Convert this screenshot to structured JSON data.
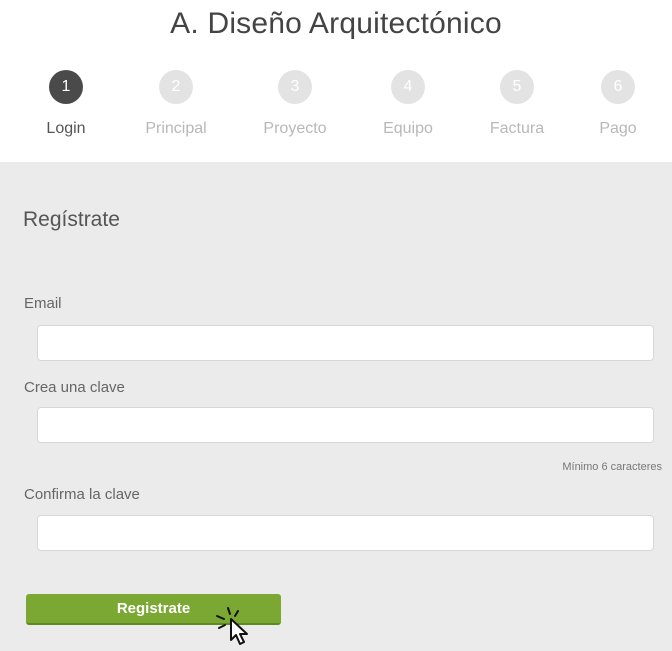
{
  "page": {
    "title": "A. Diseño Arquitectónico"
  },
  "stepper": {
    "steps": [
      {
        "number": "1",
        "label": "Login",
        "active": true
      },
      {
        "number": "2",
        "label": "Principal",
        "active": false
      },
      {
        "number": "3",
        "label": "Proyecto",
        "active": false
      },
      {
        "number": "4",
        "label": "Equipo",
        "active": false
      },
      {
        "number": "5",
        "label": "Factura",
        "active": false
      },
      {
        "number": "6",
        "label": "Pago",
        "active": false
      }
    ]
  },
  "form": {
    "heading": "Regístrate",
    "email": {
      "label": "Email",
      "value": "",
      "placeholder": ""
    },
    "password": {
      "label": "Crea una clave",
      "value": "",
      "placeholder": "",
      "hint": "Mínimo 6 caracteres"
    },
    "confirm_password": {
      "label": "Confirma la clave",
      "value": "",
      "placeholder": ""
    },
    "submit_label": "Registrate"
  },
  "colors": {
    "accent_green": "#7aa832",
    "step_active": "#4a4a4a",
    "step_inactive": "#e3e3e3",
    "panel_background": "#ebebeb"
  },
  "icons": {
    "cursor": "pointer-hand-click-icon"
  }
}
